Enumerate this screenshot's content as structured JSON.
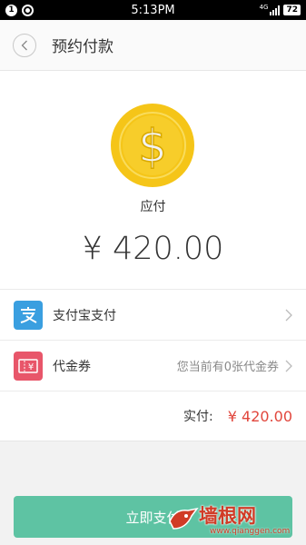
{
  "status_bar": {
    "notification_count": "1",
    "time": "5:13PM",
    "network": "4G",
    "battery": "72"
  },
  "header": {
    "title": "预约付款"
  },
  "amount": {
    "label": "应付",
    "value": "¥ 420.00"
  },
  "payment_rows": [
    {
      "label": "支付宝支付",
      "icon": "alipay-icon",
      "icon_color": "#3a9fe0",
      "hint": ""
    },
    {
      "label": "代金券",
      "icon": "voucher-icon",
      "icon_color": "#e8566a",
      "hint": "您当前有0张代金券"
    }
  ],
  "total": {
    "label": "实付:",
    "value": "¥ 420.00"
  },
  "pay_button": {
    "label": "立即支付"
  },
  "watermark": {
    "text": "墙根网",
    "url": "www.qianggen.com"
  },
  "colors": {
    "accent": "#5ec3a3",
    "price_red": "#e1463c",
    "coin_yellow": "#f5c518"
  }
}
